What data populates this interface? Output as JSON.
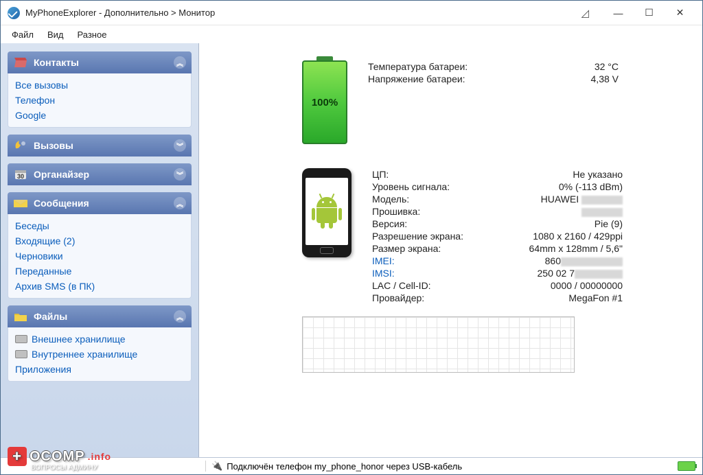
{
  "title": "MyPhoneExplorer -  Дополнительно > Монитор",
  "menu": {
    "file": "Файл",
    "view": "Вид",
    "misc": "Разное"
  },
  "sidebar": {
    "contacts": {
      "title": "Контакты",
      "items": [
        "Все вызовы",
        "Телефон",
        "Google"
      ]
    },
    "calls": {
      "title": "Вызовы"
    },
    "organizer": {
      "title": "Органайзер"
    },
    "messages": {
      "title": "Сообщения",
      "items": [
        "Беседы",
        "Входящие (2)",
        "Черновики",
        "Переданные",
        "Архив SMS (в ПК)"
      ]
    },
    "files": {
      "title": "Файлы",
      "items": [
        "Внешнее хранилище",
        "Внутреннее хранилище",
        "Приложения"
      ]
    }
  },
  "battery": {
    "pct": "100%",
    "temp_label": "Температура батареи:",
    "temp_value": "32 °C",
    "volt_label": "Напряжение батареи:",
    "volt_value": "4,38 V"
  },
  "device": {
    "cpu_label": "ЦП:",
    "cpu_value": "Не указано",
    "signal_label": "Уровень сигнала:",
    "signal_value": "0% (-113 dBm)",
    "model_label": "Модель:",
    "model_value": "HUAWEI ",
    "fw_label": "Прошивка:",
    "fw_value": "",
    "ver_label": "Версия:",
    "ver_value": "Pie (9)",
    "res_label": "Разрешение экрана:",
    "res_value": "1080 x 2160  /  429ppi",
    "size_label": "Размер экрана:",
    "size_value": "64mm x 128mm  /  5,6\"",
    "imei_label": "IMEI:",
    "imei_value": "860",
    "imsi_label": "IMSI:",
    "imsi_value": "250 02 7",
    "lac_label": "LAC / Cell-ID:",
    "lac_value": "0000 / 00000000",
    "prov_label": "Провайдер:",
    "prov_value": "MegaFon #1"
  },
  "status": "Подключён телефон my_phone_honor через USB-кабель",
  "watermark": {
    "brand": "OCOMP",
    "tld": ".info",
    "sub": "ВОПРОСЫ АДМИНУ"
  }
}
